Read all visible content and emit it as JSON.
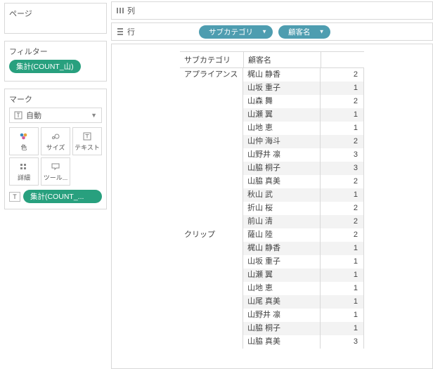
{
  "sidebar": {
    "pages_label": "ページ",
    "filter_label": "フィルター",
    "filter_pill": "集計(COUNT_山)",
    "marks_label": "マーク",
    "mark_type": "自動",
    "mark_buttons": {
      "color": "色",
      "size": "サイズ",
      "text": "テキスト",
      "detail": "詳細",
      "tooltip": "ツール..."
    },
    "mark_text_pill": "集計(COUNT_..."
  },
  "shelves": {
    "columns_label": "列",
    "rows_label": "行",
    "row_pills": [
      "サブカテゴリ",
      "顧客名"
    ]
  },
  "table": {
    "headers": {
      "subcategory": "サブカテゴリ",
      "customer": "顧客名"
    },
    "groups": [
      {
        "label": "アプライアンス",
        "rows": [
          {
            "name": "梶山 静香",
            "val": 2
          },
          {
            "name": "山坂 重子",
            "val": 1
          },
          {
            "name": "山森 舞",
            "val": 2
          },
          {
            "name": "山瀬 翼",
            "val": 1
          },
          {
            "name": "山地 恵",
            "val": 1
          },
          {
            "name": "山仲 海斗",
            "val": 2
          },
          {
            "name": "山野井 凛",
            "val": 3
          },
          {
            "name": "山脇 桐子",
            "val": 3
          },
          {
            "name": "山脇 真美",
            "val": 2
          },
          {
            "name": "秋山 武",
            "val": 1
          },
          {
            "name": "折山 桜",
            "val": 2
          },
          {
            "name": "前山 清",
            "val": 2
          }
        ]
      },
      {
        "label": "クリップ",
        "rows": [
          {
            "name": "薩山 陸",
            "val": 2
          },
          {
            "name": "梶山 静香",
            "val": 1
          },
          {
            "name": "山坂 重子",
            "val": 1
          },
          {
            "name": "山瀬 翼",
            "val": 1
          },
          {
            "name": "山地 恵",
            "val": 1
          },
          {
            "name": "山尾 真美",
            "val": 1
          },
          {
            "name": "山野井 凛",
            "val": 1
          },
          {
            "name": "山脇 桐子",
            "val": 1
          },
          {
            "name": "山脇 真美",
            "val": 3
          }
        ]
      }
    ]
  }
}
